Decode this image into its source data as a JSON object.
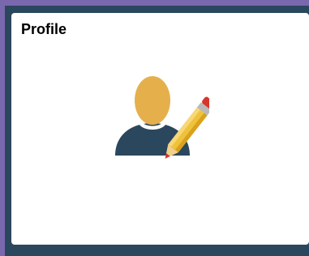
{
  "tile": {
    "title": "Profile",
    "icon": "profile-edit-icon"
  },
  "colors": {
    "background": "#2b475d",
    "frame_accent": "#7a68ae",
    "tile_background": "#ffffff",
    "head": "#e5b04c",
    "body": "#2b475d",
    "pencil_body": "#f0c23c",
    "pencil_eraser": "#d9342b"
  }
}
